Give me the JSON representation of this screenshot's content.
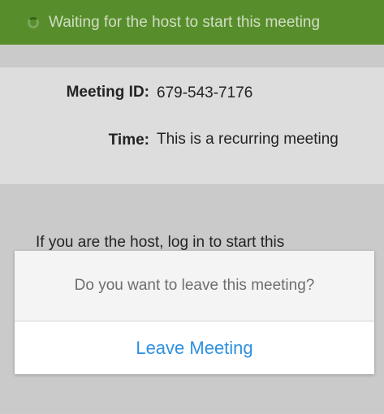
{
  "status_bar": {
    "text": "Waiting for the host to start this meeting",
    "icon": "loading-spinner-icon",
    "color": "#5f9b2f"
  },
  "meeting_info": {
    "id_label": "Meeting ID:",
    "id_value": "679-543-7176",
    "time_label": "Time:",
    "time_value": "This is a recurring meeting"
  },
  "host_message": "If you are the host, log in to start this",
  "dialog": {
    "message": "Do you want to leave this meeting?",
    "leave_label": "Leave Meeting",
    "accent_color": "#2e90e0"
  }
}
